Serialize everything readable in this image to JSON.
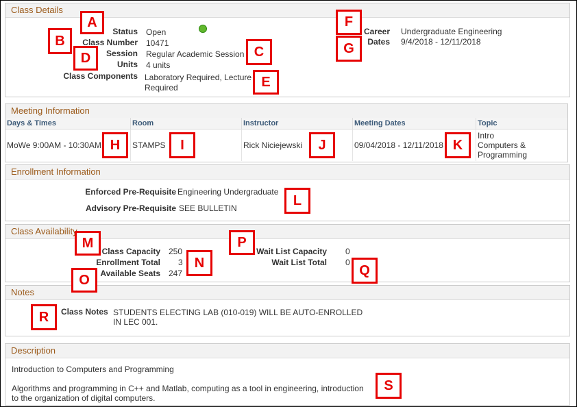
{
  "class_details": {
    "title": "Class Details",
    "status_label": "Status",
    "status_value": "Open",
    "status_color": "#62b82e",
    "class_number_label": "Class Number",
    "class_number_value": "10471",
    "session_label": "Session",
    "session_value": "Regular Academic Session",
    "units_label": "Units",
    "units_value": "4 units",
    "components_label": "Class Components",
    "components_value_line1": "Laboratory Required, Lecture",
    "components_value_line2": "Required",
    "career_label": "Career",
    "career_value": "Undergraduate Engineering",
    "dates_label": "Dates",
    "dates_value": "9/4/2018 - 12/11/2018"
  },
  "meeting_info": {
    "title": "Meeting Information",
    "columns": [
      "Days & Times",
      "Room",
      "Instructor",
      "Meeting Dates",
      "Topic"
    ],
    "rows": [
      {
        "days_times": "MoWe 9:00AM - 10:30AM",
        "room": "STAMPS",
        "instructor": "Rick Niciejewski",
        "meeting_dates": "09/04/2018 - 12/11/2018",
        "topic_line1": "Intro",
        "topic_line2": "Computers &",
        "topic_line3": "Programming"
      }
    ]
  },
  "enrollment_info": {
    "title": "Enrollment Information",
    "enforced_label": "Enforced Pre-Requisite",
    "enforced_value": "Engineering Undergraduate",
    "advisory_label": "Advisory Pre-Requisite",
    "advisory_value": "SEE BULLETIN"
  },
  "class_availability": {
    "title": "Class Availability",
    "capacity_label": "Class Capacity",
    "capacity_value": "250",
    "enrollment_total_label": "Enrollment Total",
    "enrollment_total_value": "3",
    "available_seats_label": "Available Seats",
    "available_seats_value": "247",
    "wait_capacity_label": "Wait List Capacity",
    "wait_capacity_value": "0",
    "wait_total_label": "Wait List Total",
    "wait_total_value": "0"
  },
  "notes": {
    "title": "Notes",
    "class_notes_label": "Class Notes",
    "class_notes_line1": "STUDENTS ELECTING LAB (010-019) WILL BE AUTO-ENROLLED",
    "class_notes_line2": "IN LEC 001."
  },
  "description": {
    "title": "Description",
    "heading": "Introduction to Computers and Programming",
    "body_line1": "Algorithms and programming in C++ and Matlab, computing as a tool in engineering, introduction",
    "body_line2": "to the organization of digital computers."
  },
  "annotations": {
    "color": "#e60000",
    "labels": [
      "A",
      "B",
      "C",
      "D",
      "E",
      "F",
      "G",
      "H",
      "I",
      "J",
      "K",
      "L",
      "M",
      "N",
      "O",
      "P",
      "Q",
      "R",
      "S"
    ]
  }
}
